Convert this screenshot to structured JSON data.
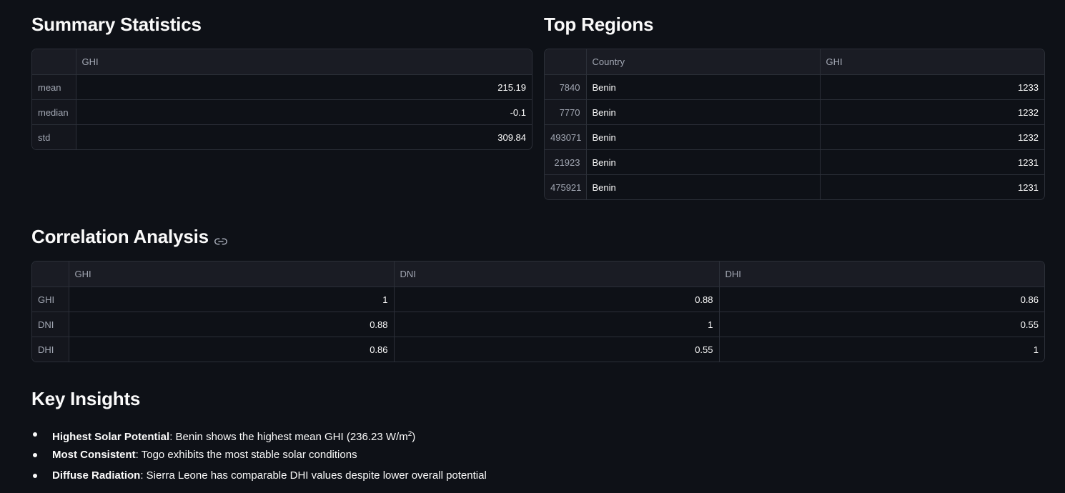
{
  "summary": {
    "title": "Summary Statistics",
    "columns": [
      "",
      "GHI"
    ],
    "rows": [
      {
        "label": "mean",
        "ghi": "215.19"
      },
      {
        "label": "median",
        "ghi": "-0.1"
      },
      {
        "label": "std",
        "ghi": "309.84"
      }
    ]
  },
  "top_regions": {
    "title": "Top Regions",
    "columns": [
      "",
      "Country",
      "GHI"
    ],
    "rows": [
      {
        "index": "7840",
        "country": "Benin",
        "ghi": "1233"
      },
      {
        "index": "7770",
        "country": "Benin",
        "ghi": "1232"
      },
      {
        "index": "493071",
        "country": "Benin",
        "ghi": "1232"
      },
      {
        "index": "21923",
        "country": "Benin",
        "ghi": "1231"
      },
      {
        "index": "475921",
        "country": "Benin",
        "ghi": "1231"
      }
    ]
  },
  "correlation": {
    "title": "Correlation Analysis",
    "link_icon": "link-icon",
    "columns": [
      "",
      "GHI",
      "DNI",
      "DHI"
    ],
    "rows": [
      {
        "label": "GHI",
        "values": [
          "1",
          "0.88",
          "0.86"
        ]
      },
      {
        "label": "DNI",
        "values": [
          "0.88",
          "1",
          "0.55"
        ]
      },
      {
        "label": "DHI",
        "values": [
          "0.86",
          "0.55",
          "1"
        ]
      }
    ]
  },
  "insights": {
    "title": "Key Insights",
    "items": [
      {
        "bold": "Highest Solar Potential",
        "text": ": Benin shows the highest mean GHI (236.23 W/m",
        "sup": "2",
        "tail": ")"
      },
      {
        "bold": "Most Consistent",
        "text": ": Togo exhibits the most stable solar conditions",
        "sup": "",
        "tail": ""
      },
      {
        "bold": "Diffuse Radiation",
        "text": ": Sierra Leone has comparable DHI values despite lower overall potential",
        "sup": "",
        "tail": ""
      }
    ]
  }
}
